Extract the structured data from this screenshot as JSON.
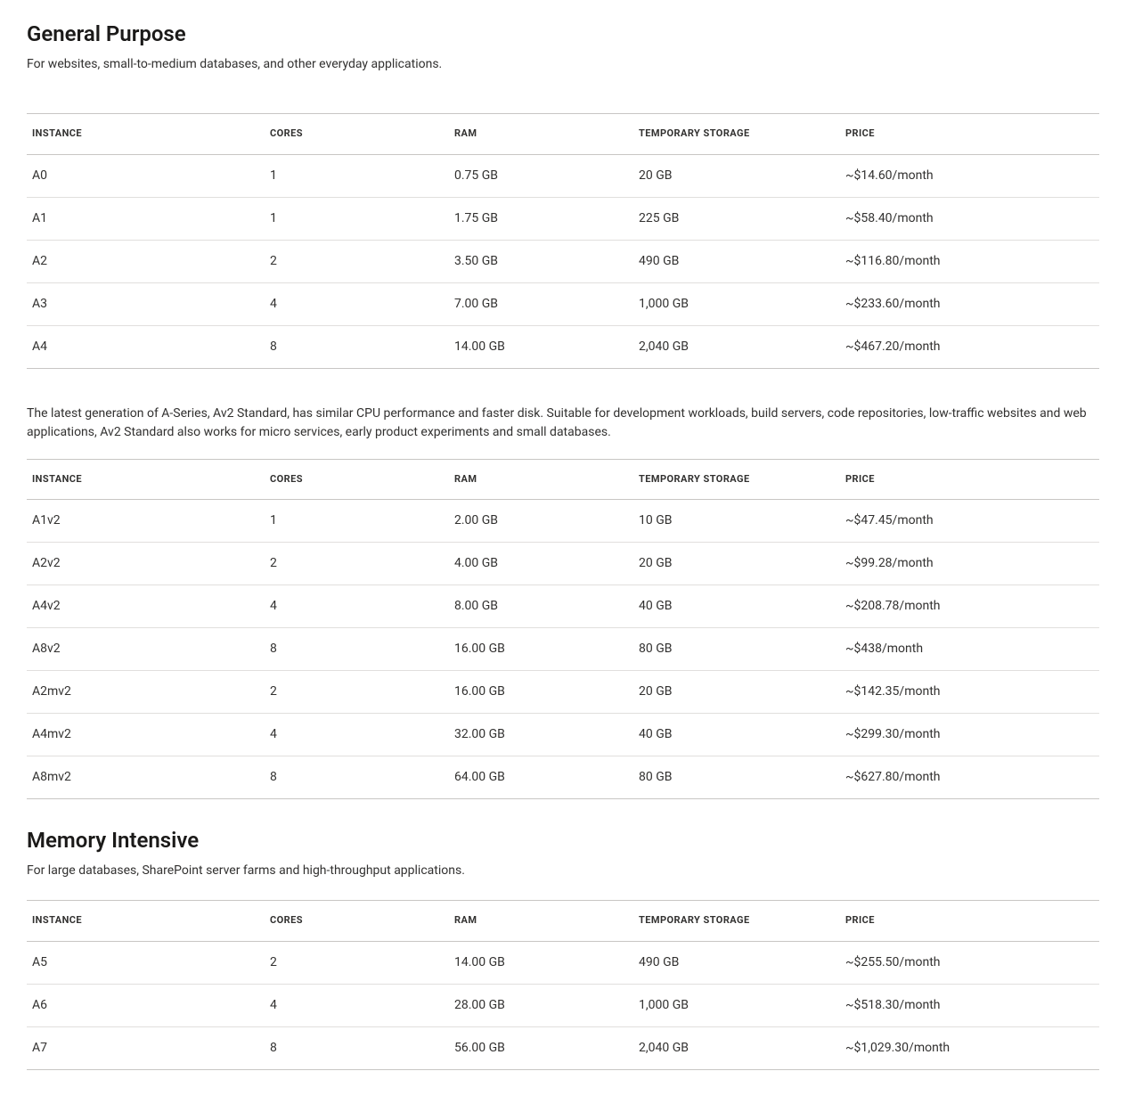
{
  "columns": {
    "instance": "INSTANCE",
    "cores": "CORES",
    "ram": "RAM",
    "storage": "TEMPORARY STORAGE",
    "price": "PRICE"
  },
  "sections": {
    "general": {
      "title": "General Purpose",
      "desc": "For websites, small-to-medium databases, and other everyday applications.",
      "interlude": "The latest generation of A-Series, Av2 Standard, has similar CPU performance and faster disk. Suitable for development workloads, build servers, code repositories, low-traffic websites and web applications, Av2 Standard also works for micro services, early product experiments and small databases.",
      "table1": [
        {
          "instance": "A0",
          "cores": "1",
          "ram": "0.75 GB",
          "storage": "20 GB",
          "price": "~$14.60/month"
        },
        {
          "instance": "A1",
          "cores": "1",
          "ram": "1.75 GB",
          "storage": "225 GB",
          "price": "~$58.40/month"
        },
        {
          "instance": "A2",
          "cores": "2",
          "ram": "3.50 GB",
          "storage": "490 GB",
          "price": "~$116.80/month"
        },
        {
          "instance": "A3",
          "cores": "4",
          "ram": "7.00 GB",
          "storage": "1,000 GB",
          "price": "~$233.60/month"
        },
        {
          "instance": "A4",
          "cores": "8",
          "ram": "14.00 GB",
          "storage": "2,040 GB",
          "price": "~$467.20/month"
        }
      ],
      "table2": [
        {
          "instance": "A1v2",
          "cores": "1",
          "ram": "2.00 GB",
          "storage": "10 GB",
          "price": "~$47.45/month"
        },
        {
          "instance": "A2v2",
          "cores": "2",
          "ram": "4.00 GB",
          "storage": "20 GB",
          "price": "~$99.28/month"
        },
        {
          "instance": "A4v2",
          "cores": "4",
          "ram": "8.00 GB",
          "storage": "40 GB",
          "price": "~$208.78/month"
        },
        {
          "instance": "A8v2",
          "cores": "8",
          "ram": "16.00 GB",
          "storage": "80 GB",
          "price": "~$438/month"
        },
        {
          "instance": "A2mv2",
          "cores": "2",
          "ram": "16.00 GB",
          "storage": "20 GB",
          "price": "~$142.35/month"
        },
        {
          "instance": "A4mv2",
          "cores": "4",
          "ram": "32.00 GB",
          "storage": "40 GB",
          "price": "~$299.30/month"
        },
        {
          "instance": "A8mv2",
          "cores": "8",
          "ram": "64.00 GB",
          "storage": "80 GB",
          "price": "~$627.80/month"
        }
      ]
    },
    "memory": {
      "title": "Memory Intensive",
      "desc": "For large databases, SharePoint server farms and high-throughput applications.",
      "table1": [
        {
          "instance": "A5",
          "cores": "2",
          "ram": "14.00 GB",
          "storage": "490 GB",
          "price": "~$255.50/month"
        },
        {
          "instance": "A6",
          "cores": "4",
          "ram": "28.00 GB",
          "storage": "1,000 GB",
          "price": "~$518.30/month"
        },
        {
          "instance": "A7",
          "cores": "8",
          "ram": "56.00 GB",
          "storage": "2,040 GB",
          "price": "~$1,029.30/month"
        }
      ]
    }
  }
}
